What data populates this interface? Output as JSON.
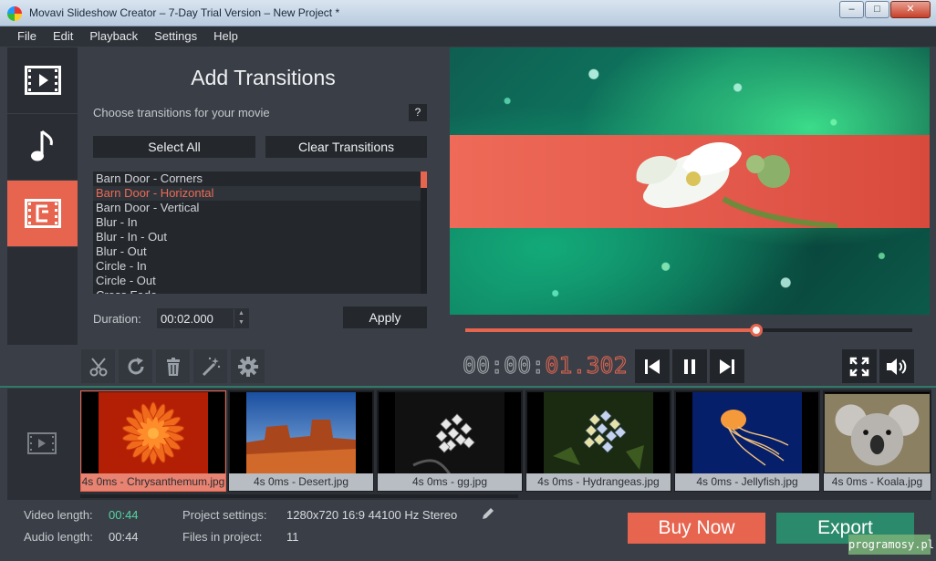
{
  "window": {
    "title": "Movavi Slideshow Creator – 7-Day Trial Version – New Project *"
  },
  "menu": [
    "File",
    "Edit",
    "Playback",
    "Settings",
    "Help"
  ],
  "panel": {
    "title": "Add Transitions",
    "subtitle": "Choose transitions for your movie",
    "help": "?",
    "select_all": "Select All",
    "clear": "Clear Transitions",
    "transitions": [
      "Barn Door - Corners",
      "Barn Door - Horizontal",
      "Barn Door - Vertical",
      "Blur - In",
      "Blur - In - Out",
      "Blur - Out",
      "Circle - In",
      "Circle - Out",
      "Cross Fade"
    ],
    "selected_index": 1,
    "duration_label": "Duration:",
    "duration_value": "00:02.000",
    "apply": "Apply"
  },
  "playback": {
    "timecode_dim": "00:00:",
    "timecode_red": "01.302",
    "progress": 0.65
  },
  "clips": [
    {
      "label": "4s 0ms - Chrysanthemum.jpg",
      "selected": true,
      "thumb": "chrysanthemum"
    },
    {
      "label": "4s 0ms - Desert.jpg",
      "selected": false,
      "thumb": "desert"
    },
    {
      "label": "4s 0ms - gg.jpg",
      "selected": false,
      "thumb": "gg"
    },
    {
      "label": "4s 0ms - Hydrangeas.jpg",
      "selected": false,
      "thumb": "hydrangeas"
    },
    {
      "label": "4s 0ms - Jellyfish.jpg",
      "selected": false,
      "thumb": "jellyfish"
    },
    {
      "label": "4s 0ms - Koala.jpg",
      "selected": false,
      "thumb": "koala"
    }
  ],
  "status": {
    "video_length_label": "Video length:",
    "video_length": "00:44",
    "audio_length_label": "Audio length:",
    "audio_length": "00:44",
    "project_settings_label": "Project settings:",
    "project_settings": "1280x720 16:9 44100 Hz Stereo",
    "files_label": "Files in project:",
    "files": "11",
    "buy_now": "Buy Now",
    "export": "Export"
  },
  "watermark": "programosy.pl",
  "colors": {
    "accent": "#e7644f",
    "export": "#2b8a6b",
    "green_text": "#54d6a2"
  }
}
